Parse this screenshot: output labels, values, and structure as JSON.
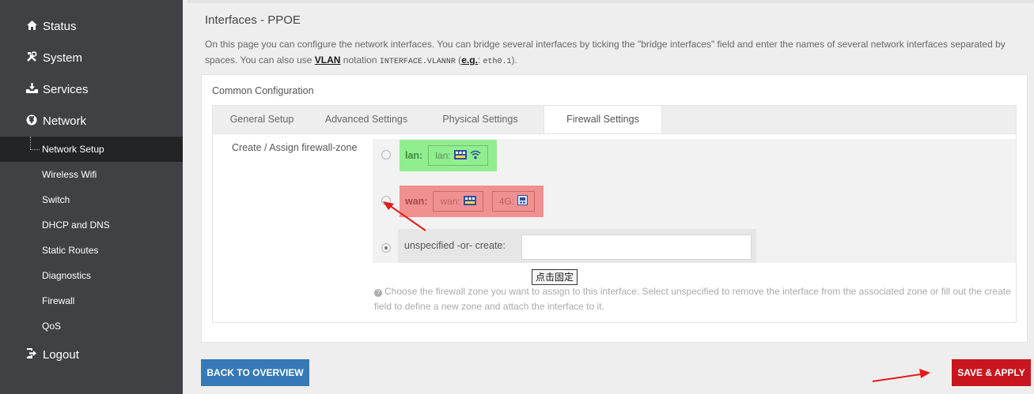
{
  "sidebar": {
    "status": {
      "label": "Status",
      "icon": "home-icon"
    },
    "system": {
      "label": "System",
      "icon": "tools-icon"
    },
    "services": {
      "label": "Services",
      "icon": "download-icon"
    },
    "network": {
      "label": "Network",
      "icon": "globe-icon"
    },
    "network_items": [
      "Network Setup",
      "Wireless Wifi",
      "Switch",
      "DHCP and DNS",
      "Static Routes",
      "Diagnostics",
      "Firewall",
      "QoS"
    ],
    "logout": {
      "label": "Logout",
      "icon": "logout-icon"
    }
  },
  "page": {
    "title": "Interfaces - PPOE",
    "desc_part1": "On this page you can configure the network interfaces. You can bridge several interfaces by ticking the \"bridge interfaces\" field and enter the names of several network interfaces separated by spaces. You can also use ",
    "vlan_link": "VLAN",
    "desc_part2": " notation ",
    "vlan_notation": "INTERFACE.VLANNR",
    "eg_open": " (",
    "eg_link": "e.g.",
    "eg_colon": ": ",
    "eg_value": "eth0.1",
    "eg_close": ")."
  },
  "config": {
    "section_title": "Common Configuration",
    "tabs": [
      "General Setup",
      "Advanced Settings",
      "Physical Settings",
      "Firewall Settings"
    ],
    "active_tab": "Firewall Settings",
    "field_label": "Create / Assign firewall-zone",
    "zones": [
      {
        "name": "lan:",
        "color": "#90ee90",
        "networks": [
          {
            "label": "lan:",
            "icons": [
              "ethernet-ports-icon",
              "wifi-icon"
            ]
          }
        ]
      },
      {
        "name": "wan:",
        "color": "#f09090",
        "networks": [
          {
            "label": "wan:",
            "icons": [
              "ethernet-ports-icon"
            ]
          },
          {
            "label": "4G:",
            "icons": [
              "usb-modem-icon"
            ]
          }
        ]
      }
    ],
    "unspecified_label": "unspecified -or- create:",
    "create_value": "",
    "selected": "unspecified",
    "pin_label": "点击固定",
    "help_text": "Choose the firewall zone you want to assign to this interface. Select unspecified to remove the interface from the associated zone or fill out the create field to define a new zone and attach the interface to it."
  },
  "buttons": {
    "back": "BACK TO OVERVIEW",
    "save": "SAVE & APPLY"
  },
  "colors": {
    "sidebar_bg": "#3f4144",
    "active_item_bg": "#222426",
    "back_btn": "#357ab7",
    "save_btn": "#c9151e",
    "arrow": "#e31b1b"
  }
}
